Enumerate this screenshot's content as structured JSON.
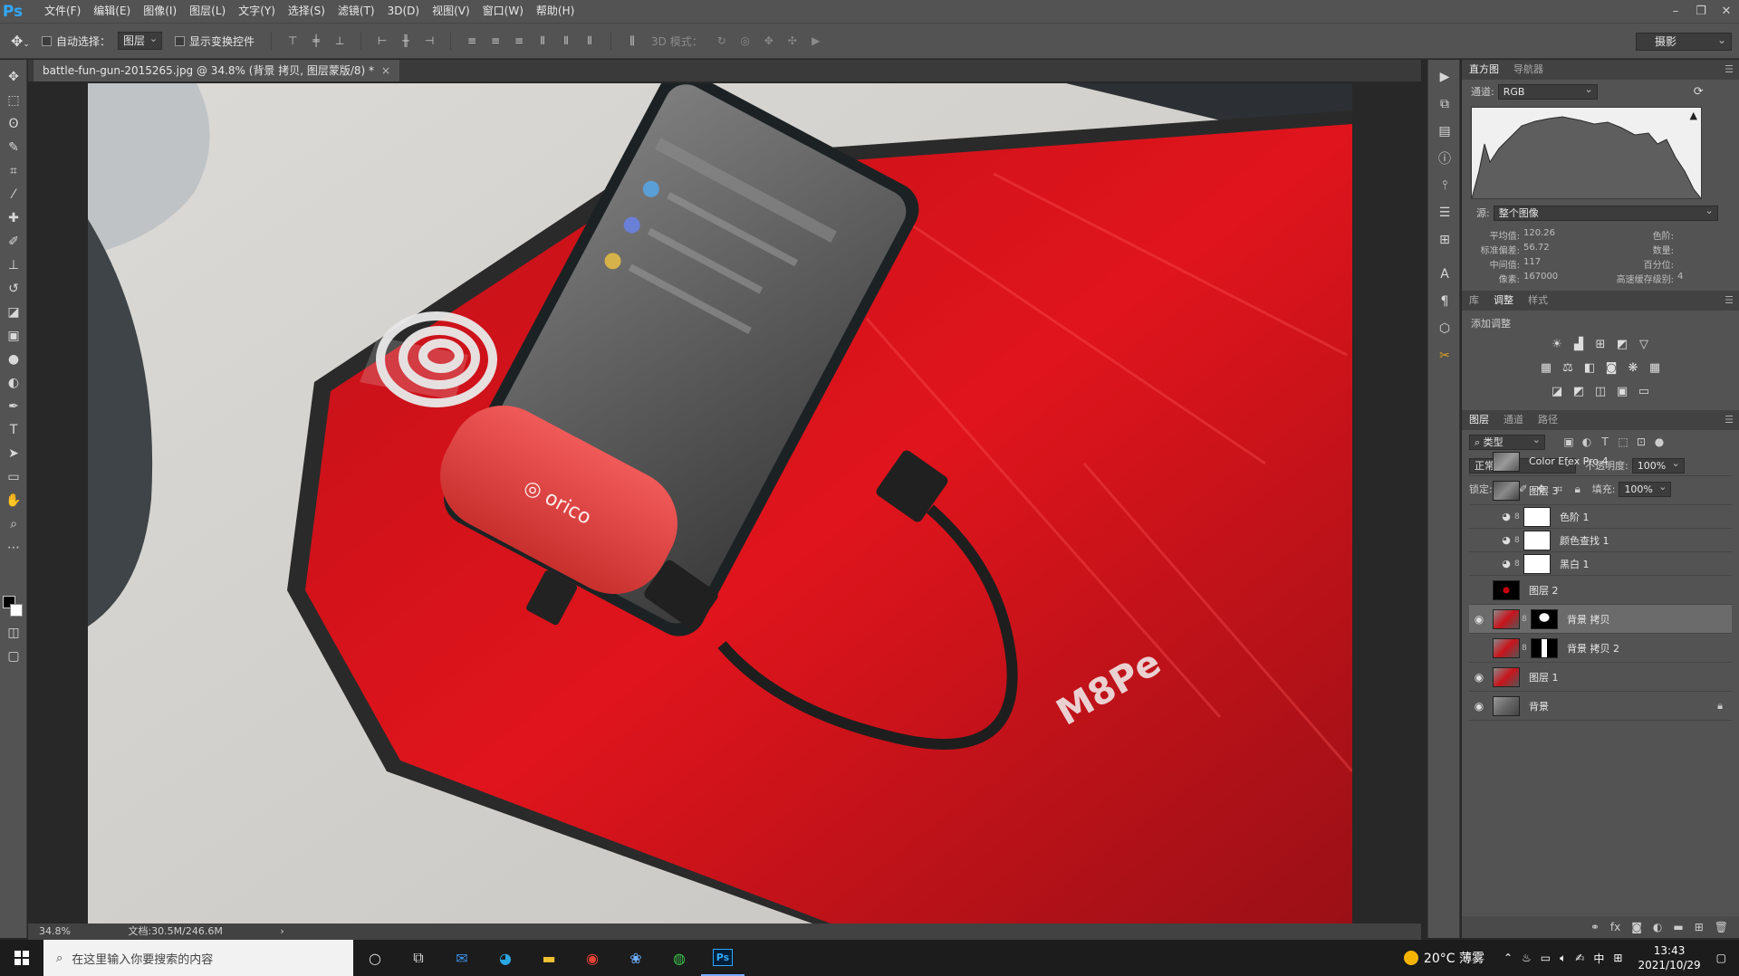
{
  "menubar": {
    "logo": "Ps",
    "items": [
      "文件(F)",
      "编辑(E)",
      "图像(I)",
      "图层(L)",
      "文字(Y)",
      "选择(S)",
      "滤镜(T)",
      "3D(D)",
      "视图(V)",
      "窗口(W)",
      "帮助(H)"
    ]
  },
  "options": {
    "auto_select_label": "自动选择：",
    "auto_select_value": "图层",
    "show_transform_label": "显示变换控件",
    "mode_3d_label": "3D 模式：",
    "workspace": "摄影"
  },
  "document": {
    "tab_title": "battle-fun-gun-2015265.jpg @ 34.8% (背景 拷贝, 图层蒙版/8) *",
    "zoom": "34.8%",
    "doc_size": "文档:30.5M/246.6M"
  },
  "histogram": {
    "tabs": [
      "直方图",
      "导航器"
    ],
    "channel_label": "通道:",
    "channel_value": "RGB",
    "source_label": "源:",
    "source_value": "整个图像",
    "stats": [
      {
        "k": "平均值:",
        "v": "120.26",
        "k2": "色阶:",
        "v2": ""
      },
      {
        "k": "标准偏差:",
        "v": "56.72",
        "k2": "数量:",
        "v2": ""
      },
      {
        "k": "中间值:",
        "v": "117",
        "k2": "百分位:",
        "v2": ""
      },
      {
        "k": "像素:",
        "v": "167000",
        "k2": "高速缓存级别:",
        "v2": "4"
      }
    ]
  },
  "adjustments": {
    "tabs": [
      "库",
      "调整",
      "样式"
    ],
    "title": "添加调整"
  },
  "layers": {
    "tabs": [
      "图层",
      "通道",
      "路径"
    ],
    "filter_value": "类型",
    "blend_mode": "正常",
    "opacity_label": "不透明度:",
    "opacity_value": "100%",
    "lock_label": "锁定:",
    "fill_label": "填充:",
    "fill_value": "100%",
    "items": [
      {
        "name": "Color Efex Pro 4"
      },
      {
        "name": "图层 3"
      },
      {
        "name": "色阶 1"
      },
      {
        "name": "颜色查找 1"
      },
      {
        "name": "黑白 1"
      },
      {
        "name": "图层 2"
      },
      {
        "name": "背景 拷贝"
      },
      {
        "name": "背景 拷贝 2"
      },
      {
        "name": "图层 1"
      },
      {
        "name": "背景"
      }
    ]
  },
  "taskbar": {
    "search_placeholder": "在这里输入你要搜索的内容",
    "weather": "20°C 薄雾",
    "time": "13:43",
    "date": "2021/10/29",
    "ime": "中"
  },
  "colors": {
    "ps_blue": "#31a8ff",
    "panel_bg": "#535353",
    "canvas_bg": "#282828",
    "mat_red": "#c8141c"
  }
}
